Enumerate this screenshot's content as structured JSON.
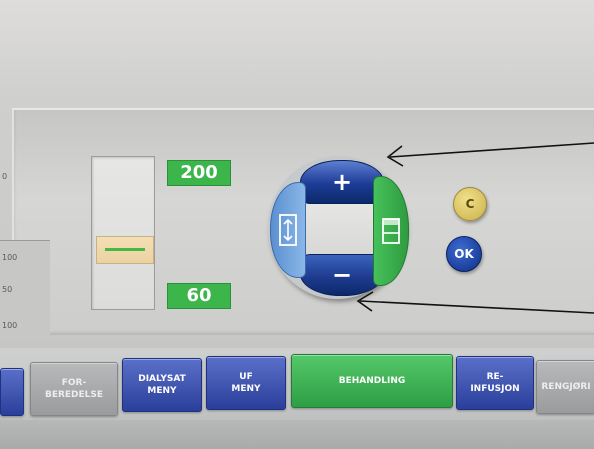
{
  "scale": {
    "upper_value": "200",
    "lower_value": "60"
  },
  "side_labels": [
    "0",
    "100",
    "50",
    "100"
  ],
  "dial": {
    "plus_label": "+",
    "minus_label": "−"
  },
  "buttons": {
    "clear_label": "C",
    "ok_label": "OK"
  },
  "tabs": [
    {
      "label": "FOR-\nBEREDELSE",
      "style": "gray"
    },
    {
      "label": "DIALYSAT\nMENY",
      "style": "blue"
    },
    {
      "label": "UF\nMENY",
      "style": "blue"
    },
    {
      "label": "BEHANDLING",
      "style": "green"
    },
    {
      "label": "RE-\nINFUSJON",
      "style": "blue"
    },
    {
      "label": "RENGJØRI",
      "style": "gray"
    }
  ],
  "colors": {
    "accent_green": "#3cb54a",
    "dial_blue": "#1d3b96",
    "ok_blue": "#0f2f88",
    "clear_yellow": "#d9c35f"
  }
}
